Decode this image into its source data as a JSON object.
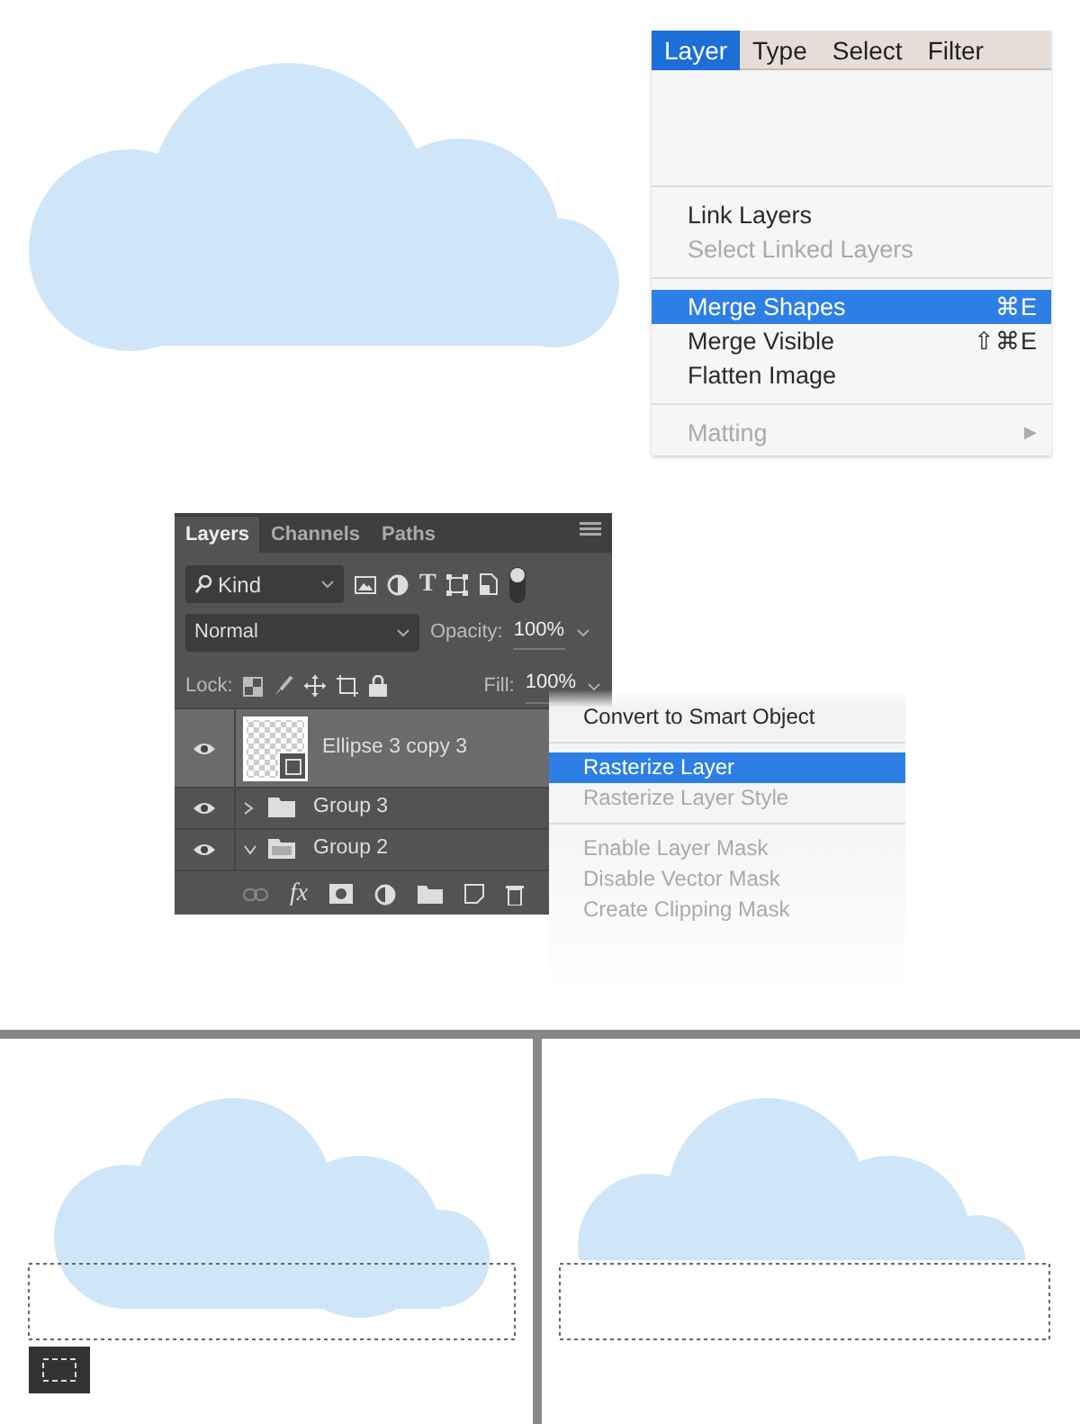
{
  "menu_bar": [
    {
      "label": "Layer",
      "selected": true
    },
    {
      "label": "Type",
      "selected": false
    },
    {
      "label": "Select",
      "selected": false
    },
    {
      "label": "Filter",
      "selected": false
    }
  ],
  "layer_menu": [
    {
      "kind": "gap"
    },
    {
      "kind": "separator"
    },
    {
      "kind": "item",
      "label": "Link Layers",
      "disabled": false,
      "highlighted": false
    },
    {
      "kind": "item",
      "label": "Select Linked Layers",
      "disabled": true,
      "highlighted": false
    },
    {
      "kind": "separator"
    },
    {
      "kind": "item",
      "label": "Merge Shapes",
      "shortcut": "⌘E",
      "disabled": false,
      "highlighted": true
    },
    {
      "kind": "item",
      "label": "Merge Visible",
      "shortcut": "⇧⌘E",
      "disabled": false,
      "highlighted": false
    },
    {
      "kind": "item",
      "label": "Flatten Image",
      "disabled": false,
      "highlighted": false
    },
    {
      "kind": "separator"
    },
    {
      "kind": "submenu",
      "label": "Matting",
      "arrow": "▶",
      "disabled": true,
      "highlighted": false
    }
  ],
  "layers_panel": {
    "tabs": [
      {
        "label": "Layers",
        "selected": true
      },
      {
        "label": "Channels",
        "selected": false
      },
      {
        "label": "Paths",
        "selected": false
      }
    ],
    "filter": "Kind",
    "filter_on": true,
    "type_glyph": "T",
    "blend_mode": "Normal",
    "opacity_label": "Opacity:",
    "opacity": "100%",
    "lock_label": "Lock:",
    "fill_label": "Fill:",
    "fill": "100%",
    "layers": [
      {
        "name": "Ellipse 3 copy 3",
        "kind": "shape",
        "visible": true,
        "selected": true
      },
      {
        "name": "Group 3",
        "kind": "group",
        "visible": true,
        "expanded": false,
        "selected": false
      },
      {
        "name": "Group 2",
        "kind": "group",
        "visible": true,
        "expanded": true,
        "selected": false
      }
    ],
    "footer_fx": "fx"
  },
  "context_menu": [
    {
      "kind": "gap"
    },
    {
      "kind": "item",
      "label": "Convert to Smart Object",
      "disabled": false,
      "highlighted": false
    },
    {
      "kind": "separator"
    },
    {
      "kind": "item",
      "label": "Rasterize Layer",
      "disabled": false,
      "highlighted": true
    },
    {
      "kind": "item",
      "label": "Rasterize Layer Style",
      "disabled": true,
      "highlighted": false
    },
    {
      "kind": "separator"
    },
    {
      "kind": "item",
      "label": "Enable Layer Mask",
      "disabled": true,
      "highlighted": false
    },
    {
      "kind": "item",
      "label": "Disable Vector Mask",
      "disabled": true,
      "highlighted": false
    },
    {
      "kind": "item",
      "label": "Create Clipping Mask",
      "disabled": true,
      "highlighted": false
    }
  ],
  "canvases": [
    {
      "kind": "full",
      "marquee_tool": true
    },
    {
      "kind": "cut",
      "marquee_tool": false
    }
  ]
}
